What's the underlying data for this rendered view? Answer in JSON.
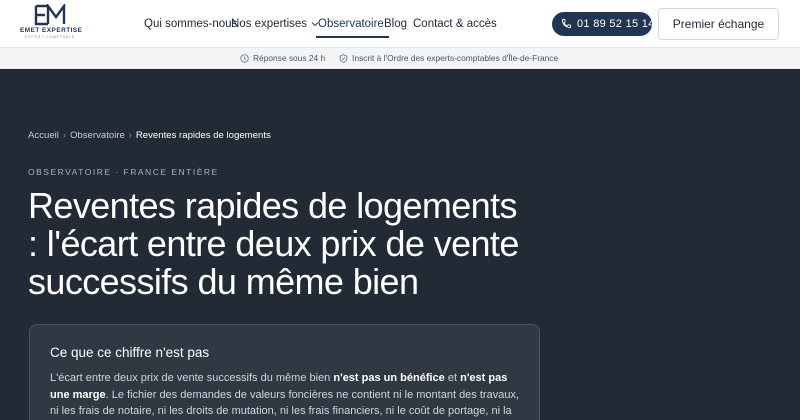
{
  "header": {
    "logo": {
      "mark": "EM",
      "name": "EMET EXPERTISE",
      "sub": "EXPERT-COMPTABLE"
    },
    "nav": [
      {
        "label": "Qui sommes-nous"
      },
      {
        "label": "Nos expertises"
      },
      {
        "label": "Observatoire"
      },
      {
        "label": "Blog"
      },
      {
        "label": "Contact & accès"
      }
    ],
    "phone": "01 89 52 15 14",
    "cta": "Premier échange"
  },
  "infobar": {
    "response": "Réponse sous 24 h",
    "registered": "Inscrit à l'Ordre des experts-comptables d'Île-de-France"
  },
  "hero": {
    "breadcrumb": [
      "Accueil",
      "Observatoire",
      "Reventes rapides de logements"
    ],
    "overline": "OBSERVATOIRE · FRANCE ENTIÈRE",
    "title": "Reventes rapides de logements : l'écart entre deux prix de vente successifs du même bien",
    "card": {
      "title": "Ce que ce chiffre n'est pas",
      "p1": "L'écart entre deux prix de vente successifs du même bien ",
      "b1": "n'est pas un bénéfice",
      "p2": " et ",
      "b2": "n'est pas une marge",
      "p3": ". Le fichier des demandes de valeurs foncières ne contient ni le montant des travaux, ni les frais de notaire, ni les droits de mutation, ni les frais financiers, ni le coût de portage, ni la"
    }
  },
  "colors": {
    "page_bg": "#222a36",
    "brand": "#1f3553",
    "card_bg": "#303844"
  }
}
